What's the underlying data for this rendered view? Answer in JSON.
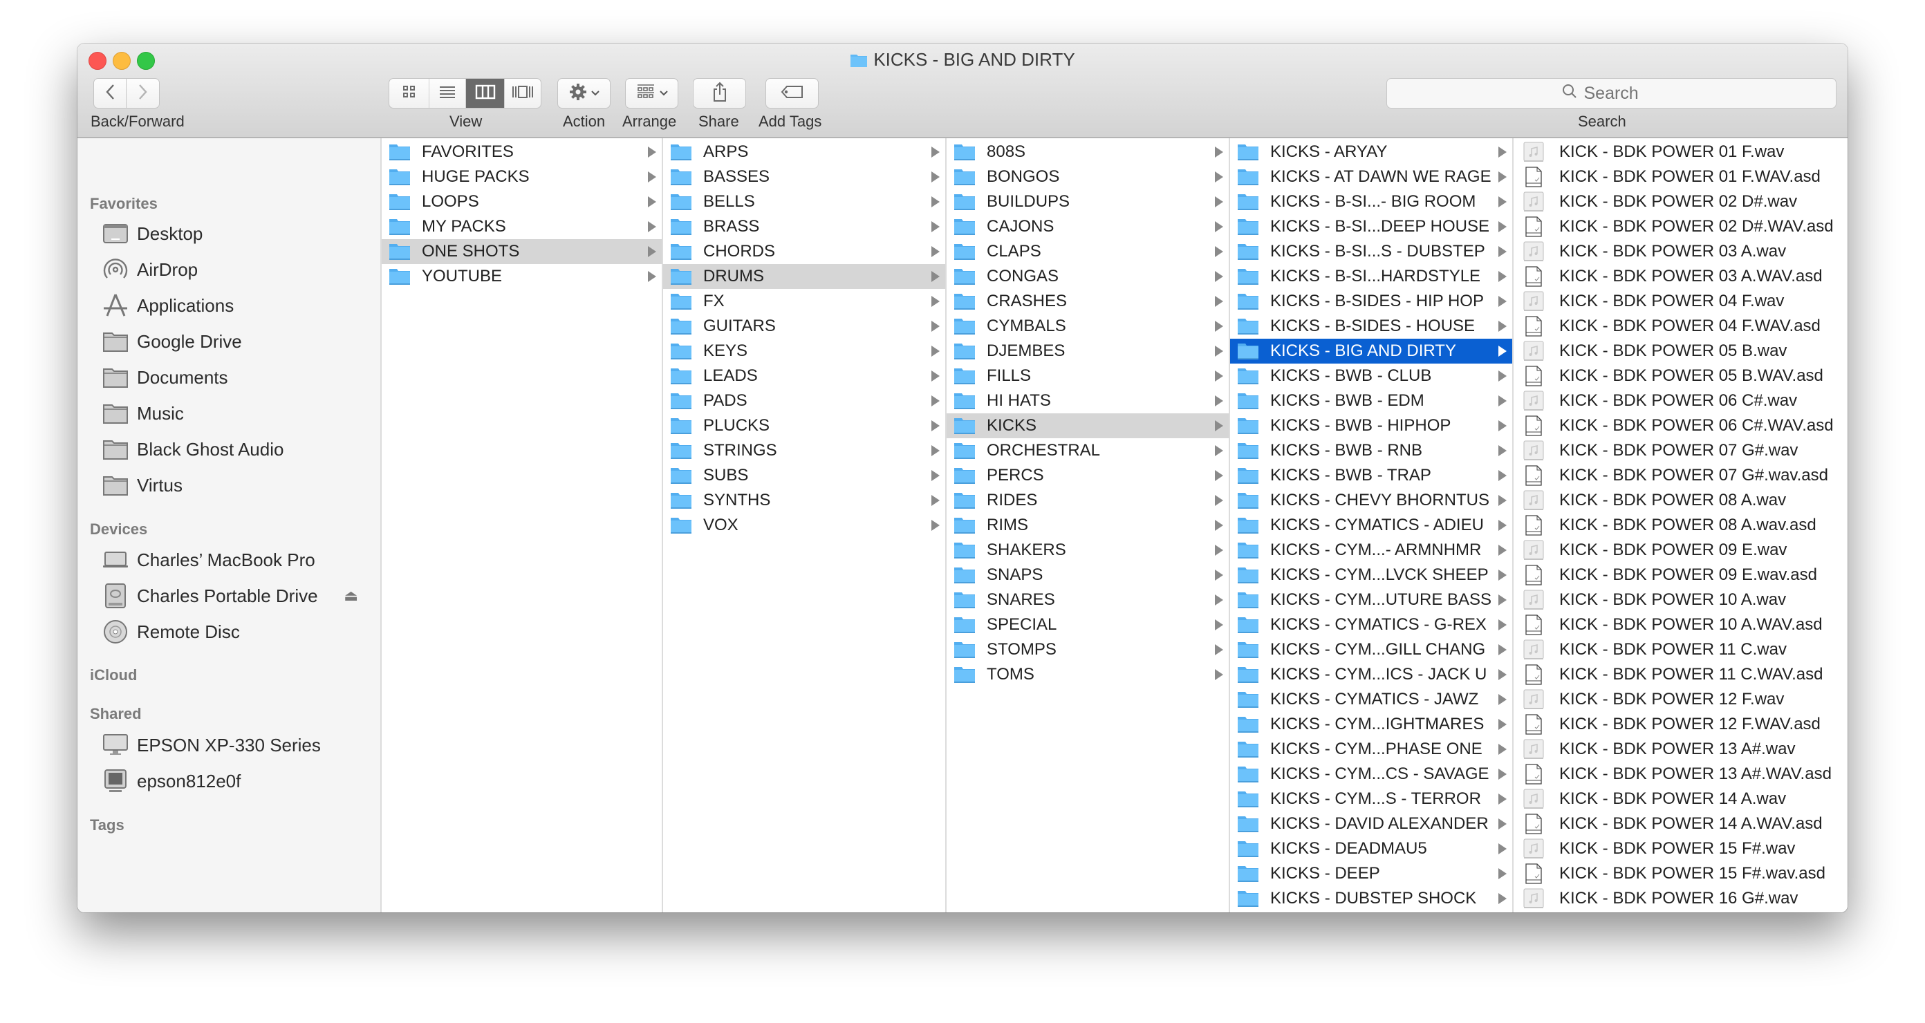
{
  "window": {
    "title": "KICKS - BIG AND DIRTY",
    "accent_color": "#0a60d2"
  },
  "toolbar": {
    "back_forward_label": "Back/Forward",
    "view_label": "View",
    "action_label": "Action",
    "arrange_label": "Arrange",
    "share_label": "Share",
    "add_tags_label": "Add Tags",
    "search_label": "Search",
    "search_placeholder": "Search",
    "view_modes": [
      "icon-view",
      "list-view",
      "column-view",
      "cover-flow-view"
    ],
    "active_view": "column-view"
  },
  "sidebar": {
    "favorites_header": "Favorites",
    "favorites": [
      {
        "label": "Desktop",
        "icon": "desktop-icon"
      },
      {
        "label": "AirDrop",
        "icon": "airdrop-icon"
      },
      {
        "label": "Applications",
        "icon": "applications-icon"
      },
      {
        "label": "Google Drive",
        "icon": "folder-icon"
      },
      {
        "label": "Documents",
        "icon": "folder-icon"
      },
      {
        "label": "Music",
        "icon": "folder-icon"
      },
      {
        "label": "Black Ghost Audio",
        "icon": "folder-icon"
      },
      {
        "label": "Virtus",
        "icon": "folder-icon"
      }
    ],
    "devices_header": "Devices",
    "devices": [
      {
        "label": "Charles’ MacBook Pro",
        "icon": "laptop-icon"
      },
      {
        "label": "Charles Portable Drive",
        "icon": "external-drive-icon",
        "ejectable": true
      },
      {
        "label": "Remote Disc",
        "icon": "disc-icon"
      }
    ],
    "icloud_header": "iCloud",
    "shared_header": "Shared",
    "shared": [
      {
        "label": "EPSON XP-330 Series",
        "icon": "display-icon"
      },
      {
        "label": "epson812e0f",
        "icon": "computer-icon"
      }
    ],
    "tags_header": "Tags"
  },
  "columns": [
    {
      "selected": 4,
      "selection_style": "gray",
      "items": [
        "FAVORITES",
        "HUGE PACKS",
        "LOOPS",
        "MY PACKS",
        "ONE SHOTS",
        "YOUTUBE"
      ]
    },
    {
      "selected": 5,
      "selection_style": "gray",
      "items": [
        "ARPS",
        "BASSES",
        "BELLS",
        "BRASS",
        "CHORDS",
        "DRUMS",
        "FX",
        "GUITARS",
        "KEYS",
        "LEADS",
        "PADS",
        "PLUCKS",
        "STRINGS",
        "SUBS",
        "SYNTHS",
        "VOX"
      ]
    },
    {
      "selected": 11,
      "selection_style": "gray",
      "items": [
        "808S",
        "BONGOS",
        "BUILDUPS",
        "CAJONS",
        "CLAPS",
        "CONGAS",
        "CRASHES",
        "CYMBALS",
        "DJEMBES",
        "FILLS",
        "HI HATS",
        "KICKS",
        "ORCHESTRAL",
        "PERCS",
        "RIDES",
        "RIMS",
        "SHAKERS",
        "SNAPS",
        "SNARES",
        "SPECIAL",
        "STOMPS",
        "TOMS"
      ]
    },
    {
      "selected": 8,
      "selection_style": "blue",
      "items": [
        "KICKS - ARYAY",
        "KICKS - AT DAWN WE RAGE",
        "KICKS - B-SI...- BIG ROOM",
        "KICKS - B-SI...DEEP HOUSE",
        "KICKS - B-SI...S - DUBSTEP",
        "KICKS - B-SI...HARDSTYLE",
        "KICKS - B-SIDES - HIP HOP",
        "KICKS - B-SIDES - HOUSE",
        "KICKS - BIG AND DIRTY",
        "KICKS - BWB - CLUB",
        "KICKS - BWB - EDM",
        "KICKS - BWB - HIPHOP",
        "KICKS - BWB - RNB",
        "KICKS - BWB - TRAP",
        "KICKS - CHEVY BHORNTUS",
        "KICKS - CYMATICS - ADIEU",
        "KICKS - CYM...- ARMNHMR",
        "KICKS - CYM...LVCK SHEEP",
        "KICKS - CYM...UTURE BASS",
        "KICKS - CYMATICS - G-REX",
        "KICKS - CYM...GILL CHANG",
        "KICKS - CYM...ICS - JACK U",
        "KICKS - CYMATICS - JAWZ",
        "KICKS - CYM...IGHTMARES",
        "KICKS - CYM...PHASE ONE",
        "KICKS - CYM...CS - SAVAGE",
        "KICKS - CYM...S - TERROR",
        "KICKS - DAVID ALEXANDER",
        "KICKS - DEADMAU5",
        "KICKS - DEEP",
        "KICKS - DUBSTEP SHOCK"
      ]
    }
  ],
  "files": [
    {
      "name": "KICK - BDK POWER 01 F.wav",
      "type": "audio"
    },
    {
      "name": "KICK - BDK POWER 01 F.WAV.asd",
      "type": "document"
    },
    {
      "name": "KICK - BDK POWER 02 D#.wav",
      "type": "audio"
    },
    {
      "name": "KICK - BDK POWER 02 D#.WAV.asd",
      "type": "document"
    },
    {
      "name": "KICK - BDK POWER 03 A.wav",
      "type": "audio"
    },
    {
      "name": "KICK - BDK POWER 03 A.WAV.asd",
      "type": "document"
    },
    {
      "name": "KICK - BDK POWER 04 F.wav",
      "type": "audio"
    },
    {
      "name": "KICK - BDK POWER 04 F.WAV.asd",
      "type": "document"
    },
    {
      "name": "KICK - BDK POWER 05 B.wav",
      "type": "audio"
    },
    {
      "name": "KICK - BDK POWER 05 B.WAV.asd",
      "type": "document"
    },
    {
      "name": "KICK - BDK POWER 06 C#.wav",
      "type": "audio"
    },
    {
      "name": "KICK - BDK POWER 06 C#.WAV.asd",
      "type": "document"
    },
    {
      "name": "KICK - BDK POWER 07 G#.wav",
      "type": "audio"
    },
    {
      "name": "KICK - BDK POWER 07 G#.wav.asd",
      "type": "document"
    },
    {
      "name": "KICK - BDK POWER 08 A.wav",
      "type": "audio"
    },
    {
      "name": "KICK - BDK POWER 08 A.wav.asd",
      "type": "document"
    },
    {
      "name": "KICK - BDK POWER 09 E.wav",
      "type": "audio"
    },
    {
      "name": "KICK - BDK POWER 09 E.wav.asd",
      "type": "document"
    },
    {
      "name": "KICK - BDK POWER 10 A.wav",
      "type": "audio"
    },
    {
      "name": "KICK - BDK POWER 10 A.WAV.asd",
      "type": "document"
    },
    {
      "name": "KICK - BDK POWER 11 C.wav",
      "type": "audio"
    },
    {
      "name": "KICK - BDK POWER 11 C.WAV.asd",
      "type": "document"
    },
    {
      "name": "KICK - BDK POWER 12 F.wav",
      "type": "audio"
    },
    {
      "name": "KICK - BDK POWER 12 F.WAV.asd",
      "type": "document"
    },
    {
      "name": "KICK - BDK POWER 13 A#.wav",
      "type": "audio"
    },
    {
      "name": "KICK - BDK POWER 13 A#.WAV.asd",
      "type": "document"
    },
    {
      "name": "KICK - BDK POWER 14 A.wav",
      "type": "audio"
    },
    {
      "name": "KICK - BDK POWER 14 A.WAV.asd",
      "type": "document"
    },
    {
      "name": "KICK - BDK POWER 15 F#.wav",
      "type": "audio"
    },
    {
      "name": "KICK - BDK POWER 15 F#.wav.asd",
      "type": "document"
    },
    {
      "name": "KICK - BDK POWER 16 G#.wav",
      "type": "audio"
    }
  ]
}
